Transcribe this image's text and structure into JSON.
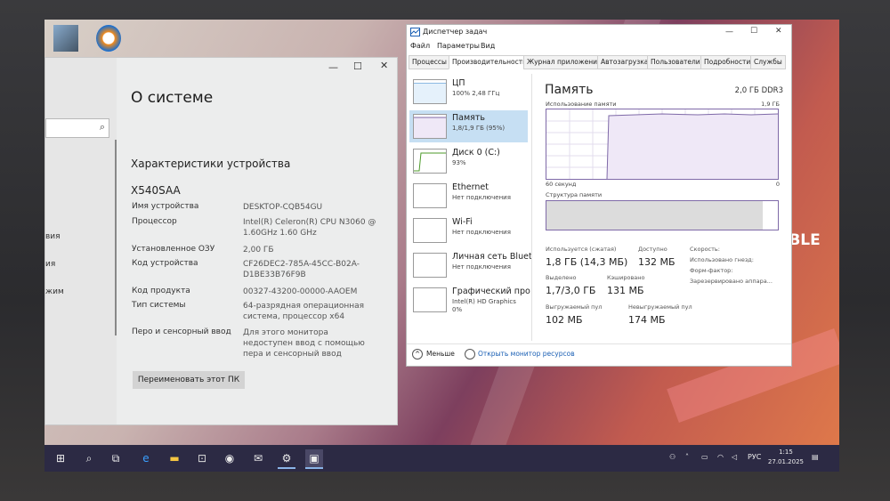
{
  "settings": {
    "page_title": "О системе",
    "section_title": "Характеристики устройства",
    "model": "X540SAA",
    "sidebar_fragments": [
      "вия",
      "ия",
      "жим"
    ],
    "specs": [
      {
        "key": "Имя устройства",
        "value": "DESKTOP-CQB54GU"
      },
      {
        "key": "Процессор",
        "value": "Intel(R) Celeron(R) CPU  N3060  @ 1.60GHz   1.60 GHz"
      },
      {
        "key": "Установленное ОЗУ",
        "value": "2,00 ГБ"
      },
      {
        "key": "Код устройства",
        "value": "CF26DEC2-785A-45CC-B02A-D1BE33B76F9B"
      },
      {
        "key": "Код продукта",
        "value": "00327-43200-00000-AAOEM"
      },
      {
        "key": "Тип системы",
        "value": "64-разрядная операционная система, процессор x64"
      },
      {
        "key": "Перо и сенсорный ввод",
        "value": "Для этого монитора недоступен ввод с помощью пера и сенсорный ввод"
      }
    ],
    "rename_label": "Переименовать этот ПК"
  },
  "task_manager": {
    "title": "Диспетчер задач",
    "menu": [
      "Файл",
      "Параметры",
      "Вид"
    ],
    "tabs": [
      "Процессы",
      "Производительность",
      "Журнал приложений",
      "Автозагрузка",
      "Пользователи",
      "Подробности",
      "Службы"
    ],
    "active_tab": 1,
    "resources": [
      {
        "name": "ЦП",
        "sub": "100%  2,48 ГГц"
      },
      {
        "name": "Память",
        "sub": "1,8/1,9 ГБ (95%)"
      },
      {
        "name": "Диск 0 (C:)",
        "sub": "93%"
      },
      {
        "name": "Ethernet",
        "sub": "Нет подключения"
      },
      {
        "name": "Wi-Fi",
        "sub": "Нет подключения"
      },
      {
        "name": "Личная сеть Bluet",
        "sub": "Нет подключения"
      },
      {
        "name": "Графический про",
        "sub": "Intel(R) HD Graphics\n0%"
      }
    ],
    "detail": {
      "title": "Память",
      "type": "2,0 ГБ DDR3",
      "usage_label": "Использование памяти",
      "usage_max": "1,9 ГБ",
      "time_label": "60 секунд",
      "zero": "0",
      "struct_label": "Структура памяти",
      "stats": [
        {
          "label": "Используется (сжатая)",
          "value": "1,8 ГБ (14,3 МБ)"
        },
        {
          "label": "Доступно",
          "value": "132 МБ"
        },
        {
          "label": "Выделено",
          "value": "1,7/3,0 ГБ"
        },
        {
          "label": "Кэшировано",
          "value": "131 МБ"
        },
        {
          "label": "Выгружаемый пул",
          "value": "102 МБ"
        },
        {
          "label": "Невыгружаемый пул",
          "value": "174 МБ"
        }
      ],
      "right_stats": [
        "Скорость:",
        "Использовано гнезд:",
        "Форм-фактор:",
        "Зарезервировано аппара..."
      ]
    },
    "footer_less": "Меньше",
    "footer_monitor": "Открыть монитор ресурсов"
  },
  "taskbar": {
    "lang": "РУС",
    "time": "1:15",
    "date": "27.01.2025"
  },
  "wallpaper_text": "IBLE",
  "colors": {
    "accent": "#0078d7",
    "selected": "#c6dff3",
    "graph_line": "#7f6aa8",
    "taskbar": "#2c2a44"
  }
}
